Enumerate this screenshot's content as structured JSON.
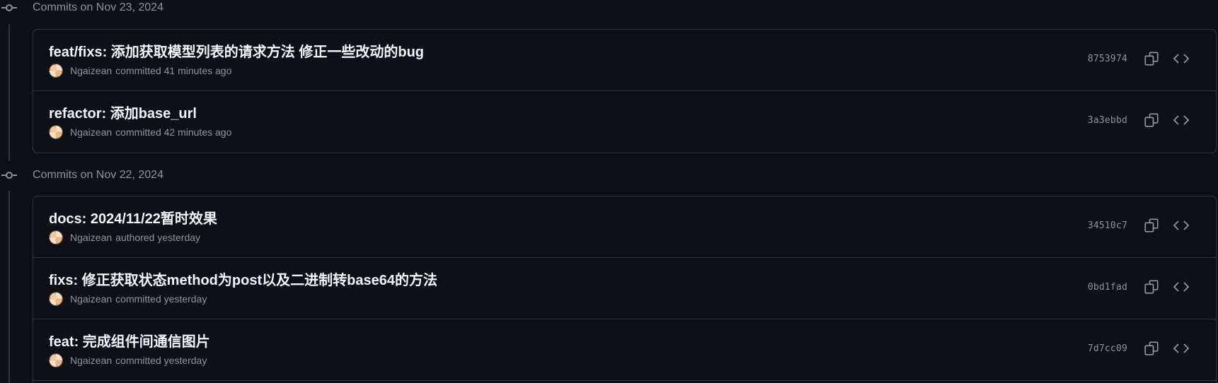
{
  "groups": [
    {
      "title": "Commits on Nov 23, 2024",
      "commits": [
        {
          "message": "feat/fixs: 添加获取模型列表的请求方法 修正一些改动的bug",
          "author": "Ngaizean",
          "action": "committed",
          "time": "41 minutes ago",
          "sha": "8753974"
        },
        {
          "message": "refactor: 添加base_url",
          "author": "Ngaizean",
          "action": "committed",
          "time": "42 minutes ago",
          "sha": "3a3ebbd"
        }
      ]
    },
    {
      "title": "Commits on Nov 22, 2024",
      "commits": [
        {
          "message": "docs: 2024/11/22暂时效果",
          "author": "Ngaizean",
          "action": "authored",
          "time": "yesterday",
          "sha": "34510c7"
        },
        {
          "message": "fixs: 修正获取状态method为post以及二进制转base64的方法",
          "author": "Ngaizean",
          "action": "committed",
          "time": "yesterday",
          "sha": "0bd1fad"
        },
        {
          "message": "feat: 完成组件间通信图片",
          "author": "Ngaizean",
          "action": "committed",
          "time": "yesterday",
          "sha": "7d7cc09"
        }
      ]
    }
  ],
  "icons": {
    "timeline": "git-commit-icon",
    "copy": "copy-icon",
    "browse": "code-icon"
  },
  "colors": {
    "background": "#0d1117",
    "border": "#30363d",
    "muted": "#8b949e",
    "title": "#f0f6fc"
  }
}
